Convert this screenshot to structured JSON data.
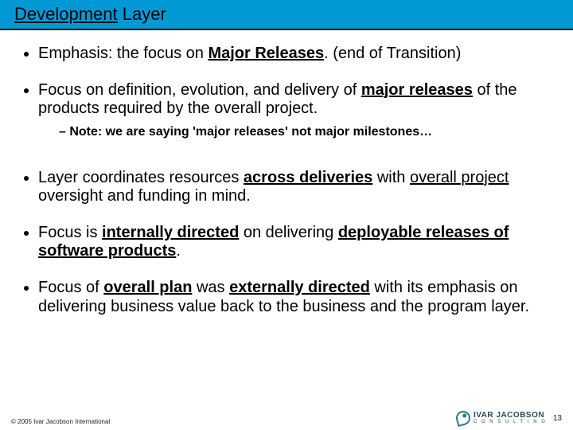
{
  "title": {
    "underlined": "Development",
    "rest": " Layer"
  },
  "bullets": {
    "b1": {
      "pre": "Emphasis:  the focus on ",
      "u1": "Major Releases",
      "post": ".  (end of Transition)"
    },
    "b2": {
      "pre": "Focus on definition, evolution, and delivery of ",
      "u1": "major releases",
      "post": " of the products required by the overall project."
    },
    "b2note": "Note:  we are saying 'major releases' not major milestones…",
    "b3": {
      "p1": "Layer coordinates resources ",
      "u1": "across deliveries",
      "p2": " with ",
      "u2": "overall project",
      "p3": " oversight and funding in mind."
    },
    "b4": {
      "p1": "Focus is ",
      "u1": "internally directed",
      "p2": " on delivering ",
      "u2": "deployable releases of software products",
      "p3": "."
    },
    "b5": {
      "p1": "Focus of ",
      "u1": "overall plan",
      "p2": " was ",
      "u2": "externally directed",
      "p3": " with its emphasis on delivering business value back to the business and the program layer."
    }
  },
  "footer": {
    "copyright": "© 2005 Ivar Jacobson International",
    "logo_line1": "IVAR JACOBSON",
    "logo_line2": "C O N S U L T I N G",
    "page": "13"
  }
}
